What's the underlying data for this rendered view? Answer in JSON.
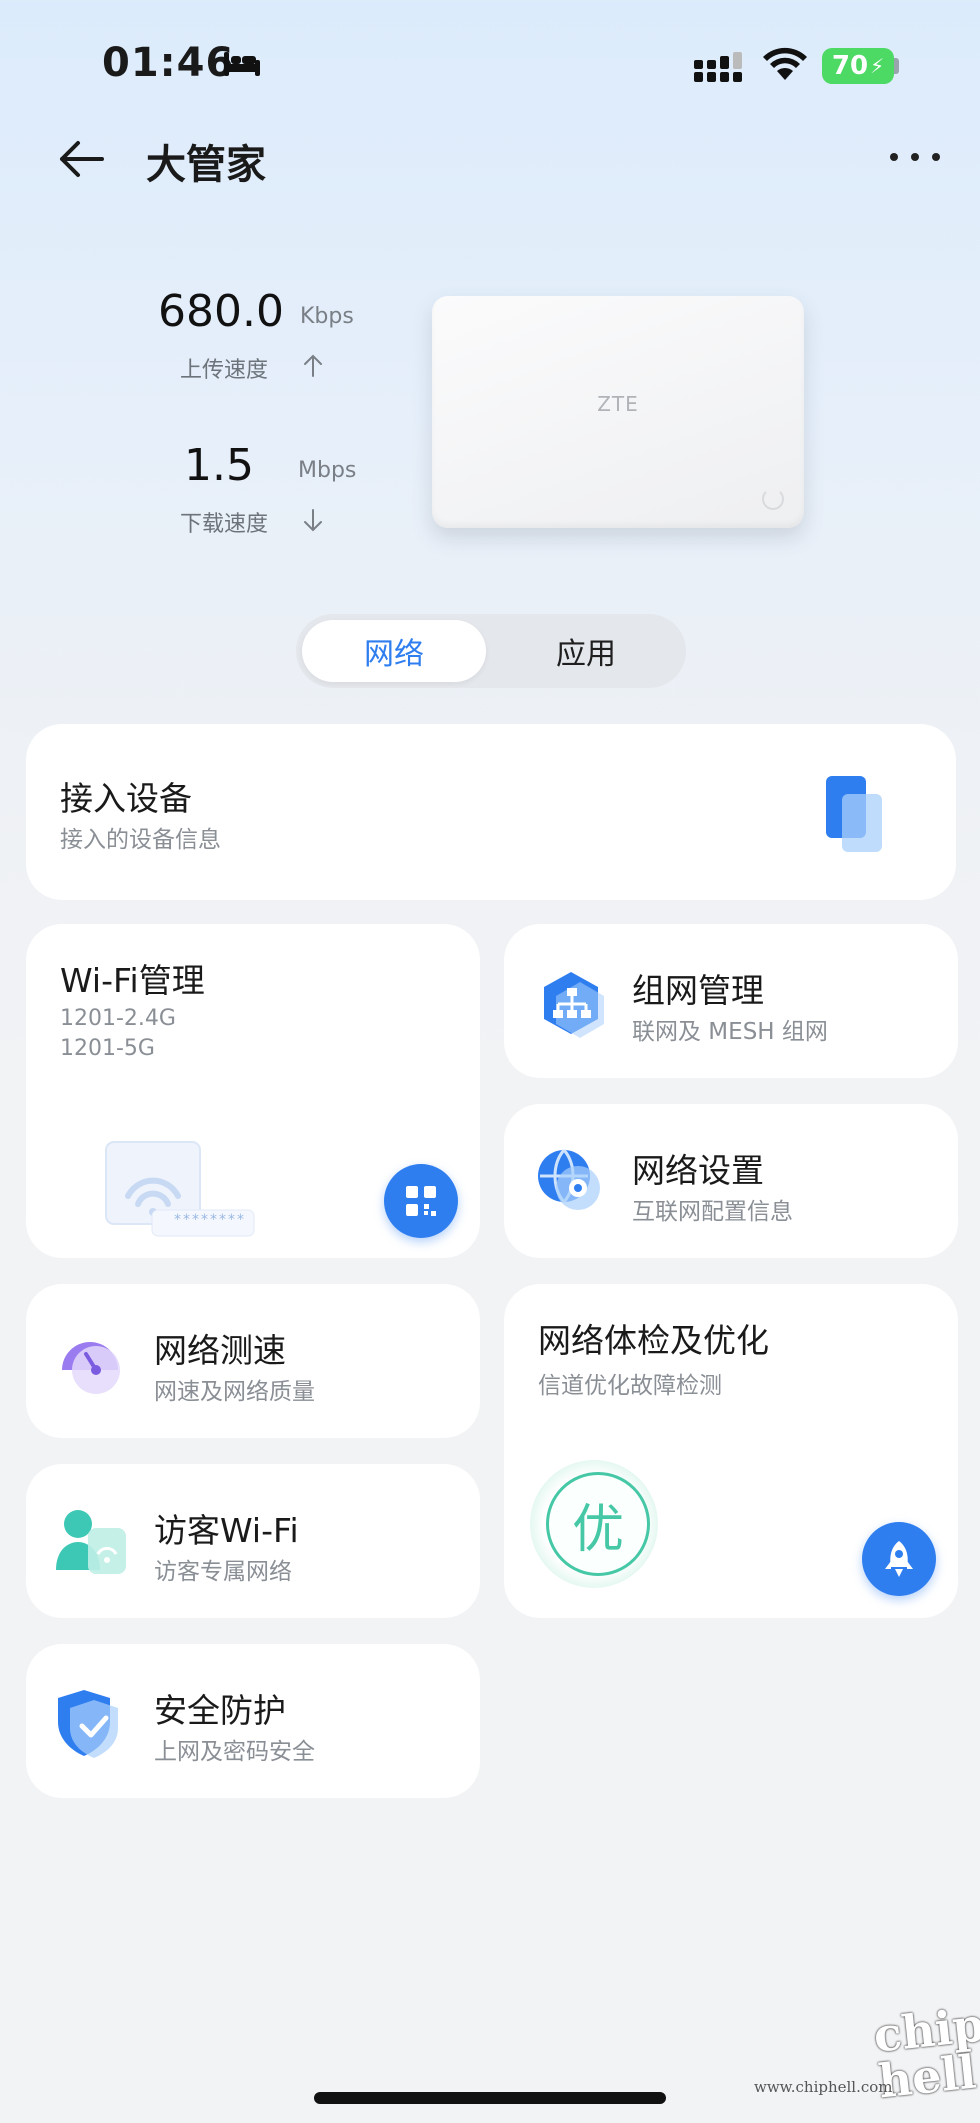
{
  "status_bar": {
    "time": "01:46",
    "battery": "70"
  },
  "header": {
    "title": "大管家"
  },
  "speed": {
    "upload": {
      "value": "680.0",
      "unit": "Kbps",
      "label": "上传速度"
    },
    "download": {
      "value": "1.5",
      "unit": "Mbps",
      "label": "下载速度"
    }
  },
  "router": {
    "brand": "ZTE"
  },
  "segment": {
    "tabs": [
      {
        "label": "网络",
        "active": true
      },
      {
        "label": "应用",
        "active": false
      }
    ]
  },
  "cards": {
    "devices": {
      "title": "接入设备",
      "subtitle": "接入的设备信息"
    },
    "wifi": {
      "title": "Wi-Fi管理",
      "ssid_24": "1201-2.4G",
      "ssid_5": "1201-5G",
      "password_mask": "********"
    },
    "mesh": {
      "title": "组网管理",
      "subtitle": "联网及 MESH 组网"
    },
    "network_settings": {
      "title": "网络设置",
      "subtitle": "互联网配置信息"
    },
    "speedtest": {
      "title": "网络测速",
      "subtitle": "网速及网络质量"
    },
    "checkup": {
      "title": "网络体检及优化",
      "subtitle": "信道优化故障检测",
      "grade": "优"
    },
    "guest_wifi": {
      "title": "访客Wi-Fi",
      "subtitle": "访客专属网络"
    },
    "security": {
      "title": "安全防护",
      "subtitle": "上网及密码安全"
    }
  },
  "watermark": {
    "site": "www.chiphell.com",
    "logo": "chip hell"
  },
  "colors": {
    "accent": "#2f7ef0",
    "grade_ring": "#46c8a6",
    "battery": "#4cd964"
  }
}
